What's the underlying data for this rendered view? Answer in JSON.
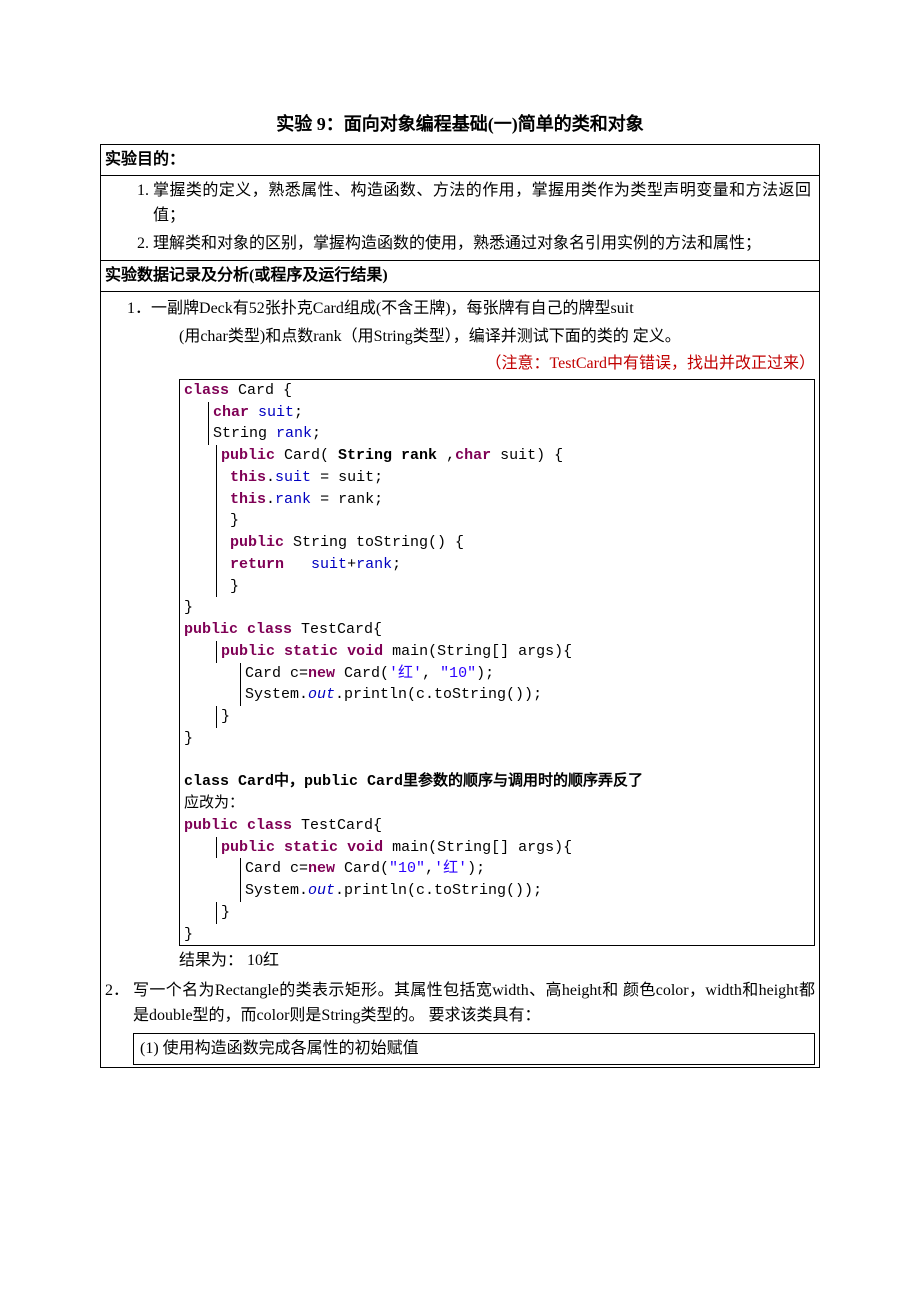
{
  "title": "实验  9：面向对象编程基础(一)简单的类和对象",
  "section_goal_header": "实验目的：",
  "goals": [
    "掌握类的定义，熟悉属性、构造函数、方法的作用，掌握用类作为类型声明变量和方法返回值；",
    "理解类和对象的区别，掌握构造函数的使用，熟悉通过对象名引用实例的方法和属性；"
  ],
  "section_data_header": "实验数据记录及分析(或程序及运行结果)",
  "q1": {
    "num": "1．",
    "l1": "一副牌Deck有52张扑克Card组成(不含王牌)，每张牌有自己的牌型suit",
    "l2": "(用char类型)和点数rank（用String类型），编译并测试下面的类的  定义。",
    "note": "（注意：TestCard中有错误，找出并改正过来）"
  },
  "code1": {
    "r1_pre": "class",
    "r1_post": " Card {",
    "r2_pre": "char",
    "r2_post": " ",
    "r2_fld": "suit",
    "r2_end": ";",
    "r3_pre": "String ",
    "r3_fld": "rank",
    "r3_end": ";",
    "r4_a": "public",
    "r4_b": " Card( ",
    "r4_c": "String rank ",
    "r4_d": ",",
    "r4_e": "char",
    "r4_f": " suit) {",
    "r5_a": "this",
    "r5_b": ".",
    "r5_c": "suit",
    "r5_d": " = suit;",
    "r6_a": "this",
    "r6_b": ".",
    "r6_c": "rank",
    "r6_d": " = rank;",
    "r7": "}",
    "r8_a": "public",
    "r8_b": " String toString() {",
    "r9_a": "return",
    "r9_b": "   ",
    "r9_c": "suit",
    "r9_d": "+",
    "r9_e": "rank",
    "r9_f": ";",
    "r10": "}",
    "r11": "}",
    "r12_a": "public",
    "r12_b": " ",
    "r12_c": "class",
    "r12_d": " TestCard{",
    "r13_a": "public",
    "r13_b": " ",
    "r13_c": "static",
    "r13_d": " ",
    "r13_e": "void",
    "r13_f": " main(String[] args){",
    "r14_a": "Card c=",
    "r14_b": "new",
    "r14_c": " Card(",
    "r14_d": "'红'",
    "r14_e": ", ",
    "r14_f": "\"10\"",
    "r14_g": ");",
    "r15_a": "System.",
    "r15_b": "out",
    "r15_c": ".println(c.toString());",
    "r16": "}",
    "r17": "}"
  },
  "explain1": "class Card中，public Card里参数的顺序与调用时的顺序弄反了",
  "explain2": "应改为：",
  "code2": {
    "r1_a": "public",
    "r1_b": " ",
    "r1_c": "class",
    "r1_d": " TestCard{",
    "r2_a": "public",
    "r2_b": " ",
    "r2_c": "static",
    "r2_d": " ",
    "r2_e": "void",
    "r2_f": " main(String[] args){",
    "r3_a": "Card c=",
    "r3_b": "new",
    "r3_c": " Card(",
    "r3_d": "\"10\"",
    "r3_e": ",",
    "r3_f": "'红'",
    "r3_g": ");",
    "r4_a": "System.",
    "r4_b": "out",
    "r4_c": ".println(c.toString());",
    "r5": "}",
    "r6": "}"
  },
  "result_label": "结果为：  10红",
  "q2": {
    "num": "2．",
    "body": "写一个名为Rectangle的类表示矩形。其属性包括宽width、高height和 颜色color，width和height都是double型的，而color则是String类型的。   要求该类具有：",
    "sub": "(1)  使用构造函数完成各属性的初始赋值"
  }
}
